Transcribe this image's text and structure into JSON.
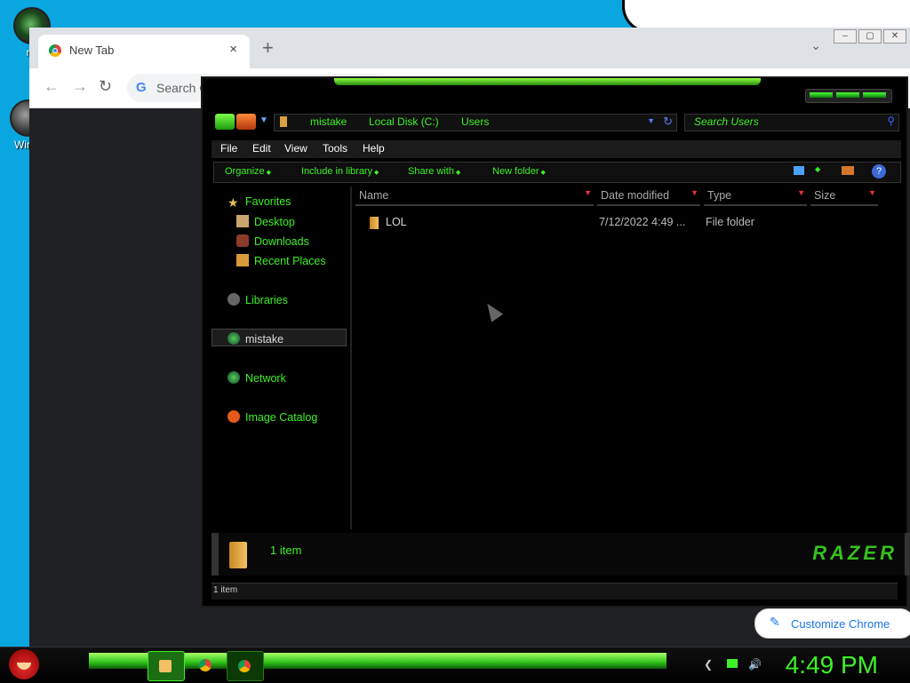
{
  "desktop": {
    "icons": [
      {
        "label": "mi"
      },
      {
        "label": "Win V"
      }
    ]
  },
  "chrome": {
    "tab_title": "New Tab",
    "tab_close": "×",
    "new_tab": "+",
    "tab_dropdown": "⌄",
    "omnibox_g": "G",
    "omnibox_placeholder": "Search G",
    "customize_label": "Customize Chrome"
  },
  "explorer": {
    "breadcrumbs": [
      "mistake",
      "Local Disk (C:)",
      "Users"
    ],
    "search_placeholder": "Search Users",
    "menu": [
      "File",
      "Edit",
      "View",
      "Tools",
      "Help"
    ],
    "commands": [
      "Organize",
      "Include in library",
      "Share with",
      "New folder"
    ],
    "nav": {
      "favorites": "Favorites",
      "desktop": "Desktop",
      "downloads": "Downloads",
      "recent": "Recent Places",
      "libraries": "Libraries",
      "user": "mistake",
      "network": "Network",
      "catalog": "Image Catalog"
    },
    "columns": [
      "Name",
      "Date modified",
      "Type",
      "Size"
    ],
    "files": [
      {
        "name": "LOL",
        "date": "7/12/2022 4:49 ...",
        "type": "File folder",
        "size": ""
      }
    ],
    "details_count": "1 item",
    "brand": "RAZER",
    "status": "1 item"
  },
  "taskbar": {
    "time": "4:49 PM"
  }
}
